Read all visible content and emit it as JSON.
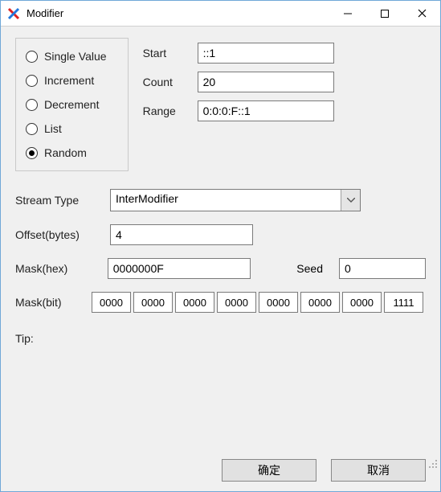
{
  "titlebar": {
    "title": "Modifier"
  },
  "radios": {
    "single": "Single Value",
    "increment": "Increment",
    "decrement": "Decrement",
    "list": "List",
    "random": "Random",
    "selected": "random"
  },
  "fields": {
    "start_label": "Start",
    "start_value": "::1",
    "count_label": "Count",
    "count_value": "20",
    "range_label": "Range",
    "range_value": "0:0:0:F::1"
  },
  "stream": {
    "label": "Stream Type",
    "value": "InterModifier"
  },
  "offset": {
    "label": "Offset(bytes)",
    "value": "4"
  },
  "maskhex": {
    "label": "Mask(hex)",
    "value": "0000000F"
  },
  "seed": {
    "label": "Seed",
    "value": "0"
  },
  "maskbit": {
    "label": "Mask(bit)",
    "cells": [
      "0000",
      "0000",
      "0000",
      "0000",
      "0000",
      "0000",
      "0000",
      "1111"
    ]
  },
  "tip": {
    "label": "Tip:"
  },
  "buttons": {
    "ok": "确定",
    "cancel": "取消"
  }
}
